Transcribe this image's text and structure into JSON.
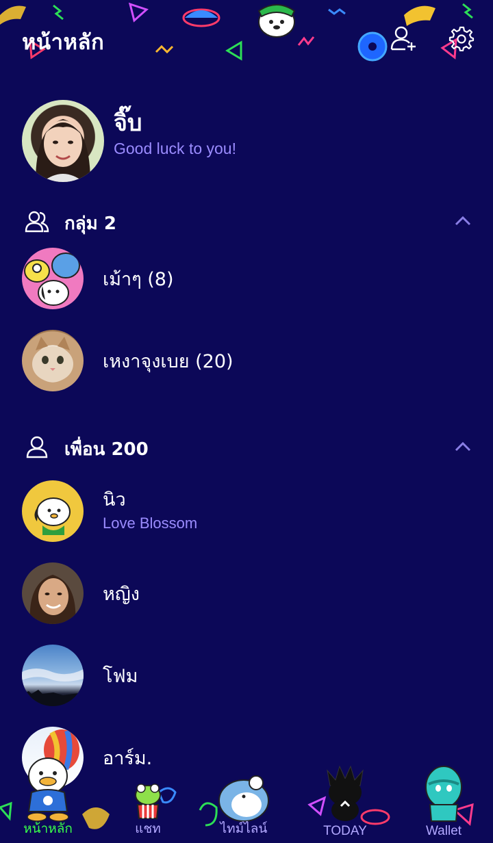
{
  "header": {
    "title": "หน้าหลัก"
  },
  "profile": {
    "name": "จิ๊บ",
    "status": "Good luck to you!"
  },
  "groups_section": {
    "label": "กลุ่ม 2"
  },
  "groups": [
    {
      "name": "เม้าๆ (8)"
    },
    {
      "name": "เหงาจุงเบย (20)"
    }
  ],
  "friends_section": {
    "label": "เพื่อน 200"
  },
  "friends": [
    {
      "name": "นิว",
      "status": "Love Blossom"
    },
    {
      "name": "หญิง"
    },
    {
      "name": "โฟม"
    },
    {
      "name": "อาร์ม."
    }
  ],
  "nav": [
    {
      "label": "หน้าหลัก",
      "active": true
    },
    {
      "label": "แชท"
    },
    {
      "label": "ไทม์ไลน์"
    },
    {
      "label": "TODAY"
    },
    {
      "label": "Wallet"
    }
  ],
  "colors": {
    "background": "#0c0858",
    "accent_text": "#9b8cff",
    "active_tab": "#39ff4a"
  }
}
